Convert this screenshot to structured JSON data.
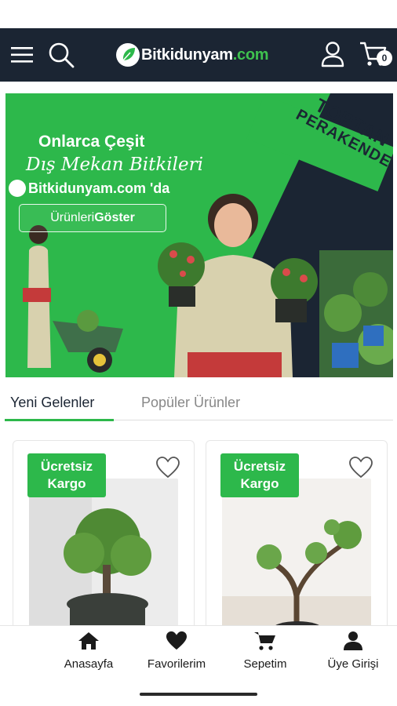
{
  "header": {
    "brand_main": "Bitkidunyam",
    "brand_suffix": ".com",
    "cart_count": "0",
    "icons": [
      "menu-icon",
      "search-icon",
      "user-icon",
      "cart-icon"
    ]
  },
  "banner": {
    "title": "Onlarca Çeşit",
    "subtitle": "Dış Mekan Bitkileri",
    "brand_line": "Bitkidunyam.com 'da",
    "button_text_regular": "Ürünleri ",
    "button_text_bold": "Göster",
    "corner_line1": "TOPTAN",
    "corner_line2": "PERAKENDE"
  },
  "tabs": {
    "active": "Yeni Gelenler",
    "inactive": "Popüler Ürünler"
  },
  "products": [
    {
      "badge_line1": "Ücretsiz",
      "badge_line2": "Kargo"
    },
    {
      "badge_line1": "Ücretsiz",
      "badge_line2": "Kargo"
    }
  ],
  "bottom_nav": {
    "home": "Anasayfa",
    "favorites": "Favorilerim",
    "cart": "Sepetim",
    "login": "Üye Girişi"
  },
  "colors": {
    "header_bg": "#1b2533",
    "accent_green": "#2db84b"
  }
}
